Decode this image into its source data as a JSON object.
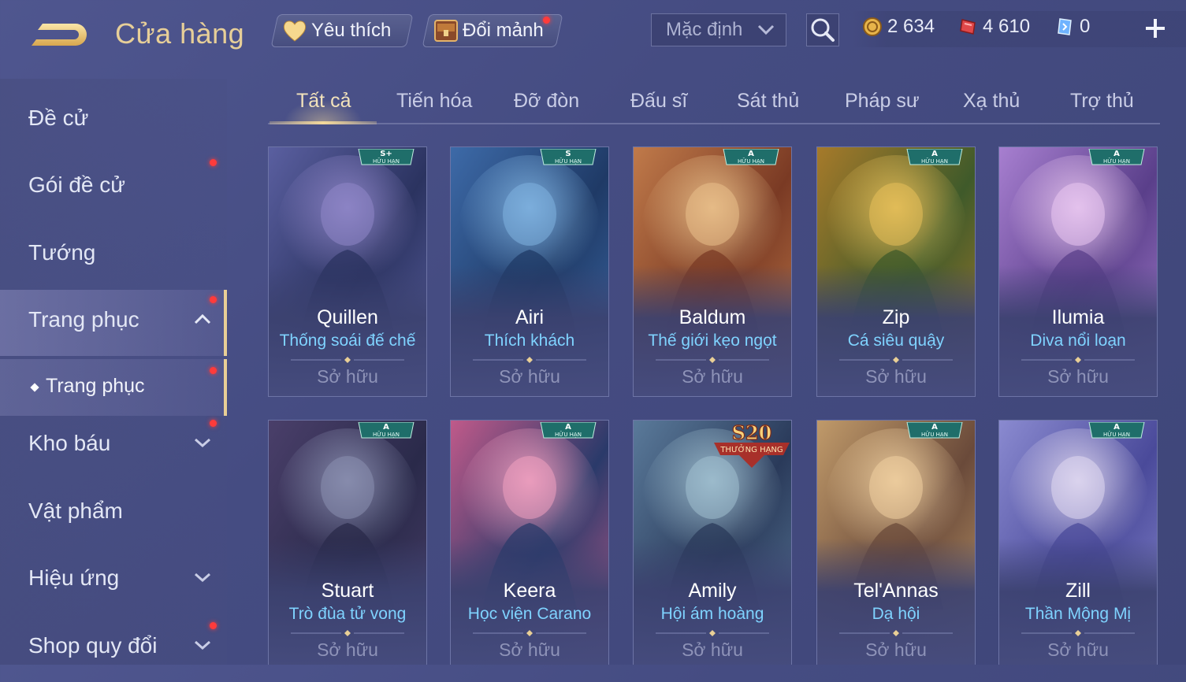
{
  "header": {
    "title": "Cửa hàng",
    "favorites_label": "Yêu thích",
    "fragments_label": "Đổi mảnh",
    "sort_selected": "Mặc định",
    "currencies": [
      {
        "name": "gold-coin",
        "amount": "2 634",
        "color": "#e7b44a"
      },
      {
        "name": "voucher",
        "amount": "4 610",
        "color": "#e0484a"
      },
      {
        "name": "crystal",
        "amount": "0",
        "color": "#6fb3ff"
      }
    ]
  },
  "sidebar": {
    "items": [
      {
        "label": "Đề cử"
      },
      {
        "label": "Gói đề cử"
      },
      {
        "label": "Tướng"
      },
      {
        "label": "Trang phục"
      },
      {
        "label": "Kho báu"
      },
      {
        "label": "Vật phẩm"
      },
      {
        "label": "Hiệu ứng"
      },
      {
        "label": "Shop quy đổi"
      }
    ],
    "sub_item": {
      "label": "Trang phục"
    }
  },
  "tabs": [
    {
      "label": "Tất cả"
    },
    {
      "label": "Tiến hóa"
    },
    {
      "label": "Đỡ đòn"
    },
    {
      "label": "Đấu sĩ"
    },
    {
      "label": "Sát thủ"
    },
    {
      "label": "Pháp sư"
    },
    {
      "label": "Xạ thủ"
    },
    {
      "label": "Trợ thủ"
    }
  ],
  "cards": [
    {
      "hero": "Quillen",
      "skin": "Thống soái đế chế",
      "status": "Sở hữu",
      "badge": "S+",
      "badge_sub": "HỮU HẠN",
      "palette": [
        "#2b3360",
        "#5a5fa0",
        "#8f86c8"
      ]
    },
    {
      "hero": "Airi",
      "skin": "Thích khách",
      "status": "Sở hữu",
      "badge": "S",
      "badge_sub": "HỮU HẠN",
      "palette": [
        "#1f3a66",
        "#3d6aa8",
        "#7fb2e0"
      ]
    },
    {
      "hero": "Baldum",
      "skin": "Thế giới kẹo ngọt",
      "status": "Sở hữu",
      "badge": "A",
      "badge_sub": "HỮU HẠN",
      "palette": [
        "#7a3a24",
        "#c07a4a",
        "#e9c08a"
      ]
    },
    {
      "hero": "Zip",
      "skin": "Cá siêu quậy",
      "status": "Sở hữu",
      "badge": "A",
      "badge_sub": "HỮU HẠN",
      "palette": [
        "#3f5a2a",
        "#a67a2a",
        "#e7c05a"
      ]
    },
    {
      "hero": "Ilumia",
      "skin": "Diva nổi loạn",
      "status": "Sở hữu",
      "badge": "A",
      "badge_sub": "HỮU HẠN",
      "palette": [
        "#5a3f8a",
        "#a77fd0",
        "#e9c7f0"
      ]
    },
    {
      "hero": "Stuart",
      "skin": "Trò đùa tử vong",
      "status": "Sở hữu",
      "badge": "A",
      "badge_sub": "HỮU HẠN",
      "palette": [
        "#2a2a4a",
        "#4a3f6a",
        "#8a8fb0"
      ]
    },
    {
      "hero": "Keera",
      "skin": "Học viện Carano",
      "status": "Sở hữu",
      "badge": "A",
      "badge_sub": "HỮU HẠN",
      "palette": [
        "#2a3a6a",
        "#c05a8a",
        "#f0a0c0"
      ]
    },
    {
      "hero": "Amily",
      "skin": "Hội ám hoàng",
      "status": "Sở hữu",
      "badge": "S20",
      "badge_sub": "THƯỞNG HẠNG",
      "palette": [
        "#2a3a5a",
        "#5a7a9a",
        "#a0c0d0"
      ]
    },
    {
      "hero": "Tel'Annas",
      "skin": "Dạ hội",
      "status": "Sở hữu",
      "badge": "A",
      "badge_sub": "HỮU HẠN",
      "palette": [
        "#6a4a3a",
        "#c09a6a",
        "#f0d0a0"
      ]
    },
    {
      "hero": "Zill",
      "skin": "Thần Mộng Mị",
      "status": "Sở hữu",
      "badge": "A",
      "badge_sub": "HỮU HẠN",
      "palette": [
        "#4a4a9a",
        "#8a8ad0",
        "#e0d8f0"
      ]
    }
  ],
  "colors": {
    "accent_gold": "#e9cf96",
    "skin_text": "#7fd3ff",
    "notification": "#ff3b3b"
  }
}
